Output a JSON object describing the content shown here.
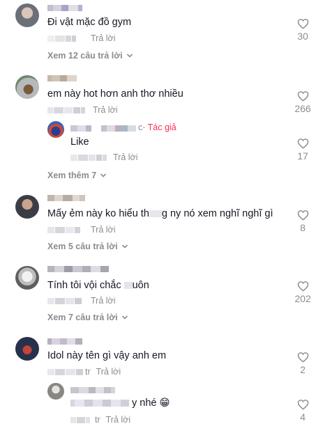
{
  "comments": [
    {
      "text": "Đi vật mặc đồ gym",
      "reply_label": "Trả lời",
      "likes": "30",
      "more_label": "Xem 12 câu trả lời"
    },
    {
      "text": "em này hot hơn anh thơ nhiều",
      "reply_label": "Trả lời",
      "likes": "266",
      "reply": {
        "username_tail": "c",
        "author_label": " · Tác giả",
        "text": "Like",
        "reply_label": "Trả lời",
        "likes": "17"
      },
      "more_label": "Xem thêm 7"
    },
    {
      "text_before": "Mấy ẻm này ko hiểu th",
      "text_after": "g ny nó xem nghĩ nghĩ gì",
      "reply_label": "Trả lời",
      "likes": "8",
      "more_label": "Xem 5 câu trả lời"
    },
    {
      "text_before": "Tính tôi vội chắc ",
      "text_after": "uôn",
      "reply_label": "Trả lời",
      "likes": "202",
      "more_label": "Xem 7 câu trả lời"
    },
    {
      "text": "Idol này tên gì vậy anh em",
      "meta_prefix": "tr",
      "reply_label": "Trả lời",
      "likes": "2",
      "reply": {
        "text_tail": "y nhé 😁",
        "meta_prefix": "tr",
        "reply_label": "Trả lời",
        "likes": "4"
      }
    }
  ],
  "colors": {
    "text": "#161823",
    "muted": "#8a8b91",
    "author": "#fe2c55"
  },
  "icons": [
    "heart-icon",
    "chevron-down-icon"
  ]
}
